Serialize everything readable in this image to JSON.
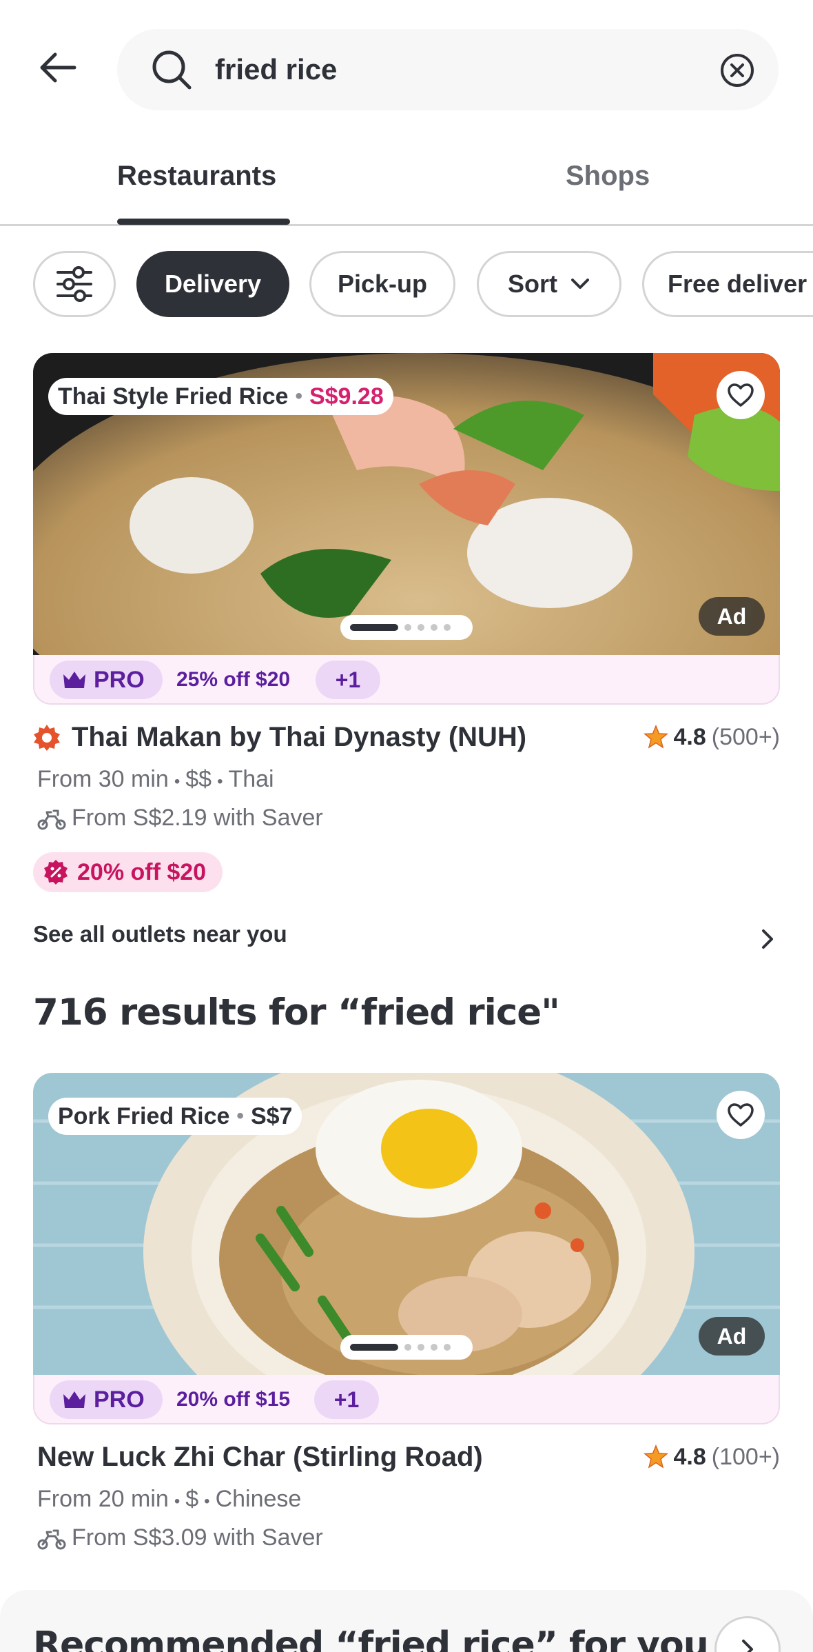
{
  "search": {
    "query": "fried rice"
  },
  "tabs": [
    {
      "label": "Restaurants",
      "active": true
    },
    {
      "label": "Shops",
      "active": false
    }
  ],
  "chips": {
    "delivery": "Delivery",
    "pickup": "Pick-up",
    "sort": "Sort",
    "free_delivery": "Free deliver"
  },
  "featured": {
    "dish_name": "Thai Style Fried Rice",
    "dish_price": "S$9.28",
    "ad": "Ad",
    "pro": "PRO",
    "promo": "25% off $20",
    "promo_more": "+1",
    "name": "Thai Makan by Thai Dynasty (NUH)",
    "rating": "4.8",
    "rating_count": "(500+)",
    "eta": "From 30 min",
    "price_level": "$$",
    "cuisine": "Thai",
    "delivery_fee": "From S$2.19 with Saver",
    "discount": "20% off $20",
    "outlets": "See all outlets near you"
  },
  "results_title": "716 results for “fried rice\"",
  "result_1": {
    "dish_name": "Pork Fried Rice",
    "dish_price": "S$7",
    "ad": "Ad",
    "pro": "PRO",
    "promo": "20% off $15",
    "promo_more": "+1",
    "name": "New Luck Zhi Char (Stirling Road)",
    "rating": "4.8",
    "rating_count": "(100+)",
    "eta": "From 20 min",
    "price_level": "$",
    "cuisine": "Chinese",
    "delivery_fee": "From S$3.09 with Saver"
  },
  "recommend_title": "Recommended “fried rice” for you",
  "colors": {
    "accent_dark": "#2e3138",
    "pro_purple": "#5b1f9e",
    "promo_pink": "#d6206f",
    "star_orange": "#f59b23"
  }
}
